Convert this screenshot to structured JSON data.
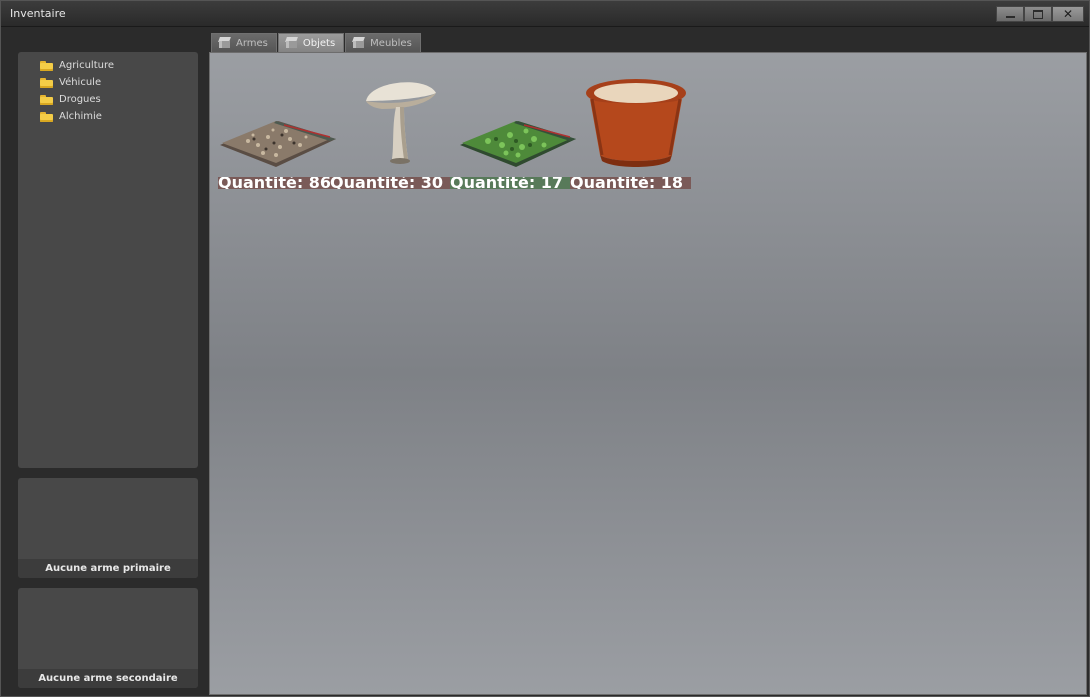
{
  "window": {
    "title": "Inventaire"
  },
  "categories": [
    {
      "label": "Agriculture"
    },
    {
      "label": "Véhicule"
    },
    {
      "label": "Drogues"
    },
    {
      "label": "Alchimie"
    }
  ],
  "weapon_slots": {
    "primary": "Aucune arme primaire",
    "secondary": "Aucune arme secondaire"
  },
  "tabs": [
    {
      "label": "Armes",
      "active": false
    },
    {
      "label": "Objets",
      "active": true
    },
    {
      "label": "Meubles",
      "active": false
    }
  ],
  "items": [
    {
      "icon": "seed-bag-icon",
      "quantity_label": "Quantité: 86",
      "label_color": "#7a5a58"
    },
    {
      "icon": "mushroom-icon",
      "quantity_label": "Quantité: 30",
      "label_color": "#7a5a58"
    },
    {
      "icon": "green-bag-icon",
      "quantity_label": "Quantité: 17",
      "label_color": "#587a5a"
    },
    {
      "icon": "flower-pot-icon",
      "quantity_label": "Quantité: 18",
      "label_color": "#7a5a58"
    }
  ]
}
